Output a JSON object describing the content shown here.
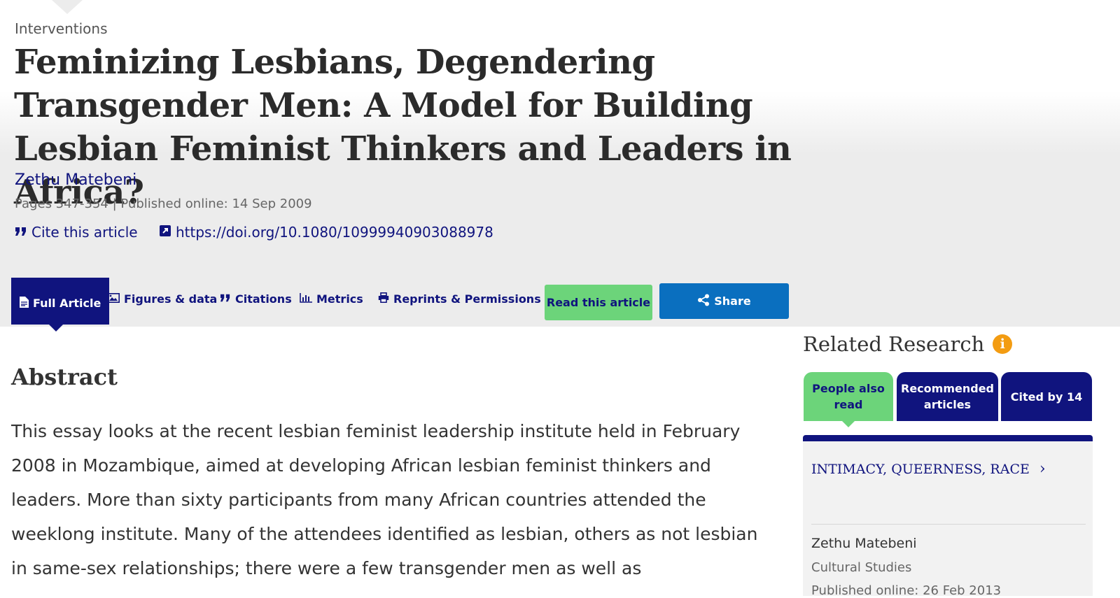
{
  "article": {
    "section": "Interventions",
    "title": "Feminizing Lesbians, Degendering Transgender Men: A Model for Building Lesbian Feminist Thinkers and Leaders in Africa?",
    "author": "Zethu Matebeni",
    "meta": "Pages 347-354 | Published online: 14 Sep 2009",
    "cite_label": "Cite this article",
    "doi": "https://doi.org/10.1080/10999940903088978"
  },
  "tabs": {
    "full_article": "Full Article",
    "figures": "Figures & data",
    "citations": "Citations",
    "metrics": "Metrics",
    "reprints": "Reprints & Permissions",
    "read": "Read this article",
    "share": "Share"
  },
  "abstract": {
    "heading": "Abstract",
    "text": "This essay looks at the recent lesbian feminist leadership institute held in February 2008 in Mozambique, aimed at developing African lesbian feminist thinkers and leaders. More than sixty participants from many African countries attended the weeklong institute. Many of the attendees identified as lesbian, others as not lesbian in same-sex relationships; there were a few transgender men as well as"
  },
  "related": {
    "title": "Related Research",
    "info_icon": "info-icon",
    "tabs": [
      "People also read",
      "Recommended articles",
      "Cited by 14"
    ],
    "item": {
      "title": "INTIMACY, QUEERNESS, RACE",
      "author": "Zethu Matebeni",
      "journal": "Cultural Studies",
      "published": "Published online: 26 Feb 2013"
    }
  },
  "colors": {
    "brand_navy": "#10147e",
    "read_green": "#6cd47a",
    "share_blue": "#0a6fbf",
    "info_orange": "#f39c12"
  }
}
